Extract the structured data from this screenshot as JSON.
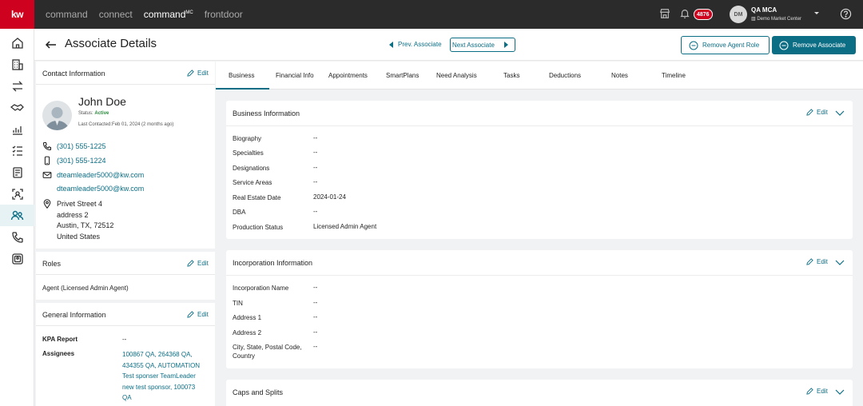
{
  "colors": {
    "brand": "#ce011f",
    "accent": "#0c6e85",
    "topbar": "#2b2b2b",
    "status_active": "#2a8a3c"
  },
  "topbar": {
    "logo": "kw",
    "nav": [
      {
        "label": "command",
        "active": false
      },
      {
        "label": "connect",
        "active": false
      },
      {
        "label": "command",
        "sup": "MC",
        "active": true
      },
      {
        "label": "frontdoor",
        "active": false
      }
    ],
    "notification_count": "4876",
    "user_initials": "DM",
    "user_name": "QA MCA",
    "market_center": "Demo Market Center",
    "icons": [
      "store-icon",
      "bell-icon",
      "chevron-down-icon",
      "help-icon"
    ]
  },
  "sidebar": {
    "items": [
      {
        "icon": "home-icon"
      },
      {
        "icon": "building-icon"
      },
      {
        "icon": "transfer-icon"
      },
      {
        "icon": "handshake-icon"
      },
      {
        "icon": "analytics-icon"
      },
      {
        "icon": "checklist-icon"
      },
      {
        "icon": "document-icon"
      },
      {
        "icon": "person-search-icon"
      },
      {
        "icon": "people-icon",
        "active": true
      },
      {
        "icon": "phone-icon"
      },
      {
        "icon": "contact-card-icon"
      }
    ]
  },
  "header": {
    "title": "Associate Details",
    "prev_label": "Prev. Associate",
    "next_label": "Next Associate",
    "remove_role_label": "Remove Agent Role",
    "remove_associate_label": "Remove Associate"
  },
  "contact": {
    "title": "Contact Information",
    "edit_label": "Edit",
    "name": "John Doe",
    "status_label": "Status:",
    "status_value": "Active",
    "last_contacted": "Last Contacted:Feb 01, 2024 (2 months ago)",
    "phone_1": "(301) 555-1225",
    "phone_2": "(301) 555-1224",
    "email_1": "dteamleader5000@kw.com",
    "email_2": "dteamleader5000@kw.com",
    "address": [
      "Privet Street 4",
      "address 2",
      "Austin, TX, 72512",
      "United States"
    ]
  },
  "roles": {
    "title": "Roles",
    "edit_label": "Edit",
    "value": "Agent (Licensed Admin Agent)"
  },
  "general": {
    "title": "General Information",
    "edit_label": "Edit",
    "kpa_label": "KPA Report",
    "kpa_value": "--",
    "assignees_label": "Assignees",
    "assignees_lines": [
      "100867 QA, 264368 QA,",
      "434355 QA, AUTOMATION",
      "Test sponser TeamLeader",
      "new test sponsor, 100073",
      "QA"
    ]
  },
  "tabs": [
    "Business",
    "Financial Info",
    "Appointments",
    "SmartPlans",
    "Need Analysis",
    "Tasks",
    "Deductions",
    "Notes",
    "Timeline"
  ],
  "active_tab": "Business",
  "business": {
    "title": "Business Information",
    "edit_label": "Edit",
    "fields": [
      {
        "label": "Biography",
        "value": "--"
      },
      {
        "label": "Specialties",
        "value": "--"
      },
      {
        "label": "Designations",
        "value": "--"
      },
      {
        "label": "Service Areas",
        "value": "--"
      },
      {
        "label": "Real Estate Date",
        "value": "2024-01-24"
      },
      {
        "label": "DBA",
        "value": "--"
      },
      {
        "label": "Production Status",
        "value": "Licensed Admin Agent"
      }
    ]
  },
  "incorporation": {
    "title": "Incorporation Information",
    "edit_label": "Edit",
    "fields": [
      {
        "label": "Incorporation Name",
        "value": "--"
      },
      {
        "label": "TIN",
        "value": "--"
      },
      {
        "label": "Address 1",
        "value": "--"
      },
      {
        "label": "Address 2",
        "value": "--"
      },
      {
        "label": "City, State, Postal Code, Country",
        "value": "--"
      }
    ]
  },
  "caps": {
    "title": "Caps and Splits",
    "edit_label": "Edit"
  }
}
